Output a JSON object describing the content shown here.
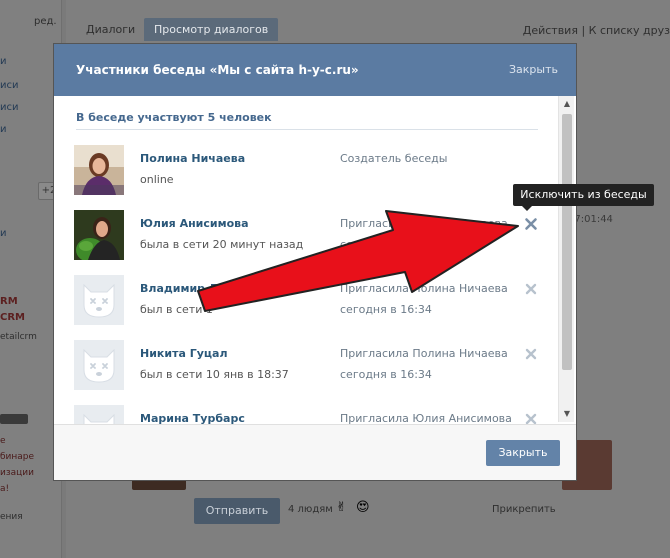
{
  "background": {
    "edit_link": "ред.",
    "sidebar_fragments": [
      "и",
      "иси",
      "иси",
      "и"
    ],
    "sidebar_fragment_2": "и",
    "plus_button": "+2",
    "ad_title_1": "RM",
    "ad_title_2": "CRM",
    "ad_subtitle": "etailcrm",
    "promo_lines": [
      "е",
      "бинаре",
      "изации",
      "а!"
    ],
    "footer_fragment": "ения",
    "tabs": [
      "Диалоги",
      "Просмотр диалогов"
    ],
    "actions": "Действия  |  К списку друз",
    "time": "17:01:44",
    "send_button": "Отправить",
    "people_count": "4 людям",
    "emoji_1": "✌",
    "emoji_2": "😍",
    "attach": "Прикрепить"
  },
  "modal": {
    "title": "Участники беседы «Мы с сайта h-y-c.ru»",
    "close_link": "Закрыть",
    "members_heading": "В беседе участвуют 5 человек",
    "members": [
      {
        "name": "Полина Ничаева",
        "status": "online",
        "role": "Создатель беседы",
        "when": "",
        "avatar": "photo",
        "removable": false
      },
      {
        "name": "Юлия Анисимова",
        "status": "была в сети 20 минут назад",
        "role": "Пригласила Полина Ничаева",
        "when": "сегодня в 1",
        "avatar": "photo",
        "removable": true
      },
      {
        "name": "Владимир Денежный",
        "status": "был в сети 1",
        "role": "Пригласила Полина Ничаева",
        "when": "сегодня в 16:34",
        "avatar": "default",
        "removable": true
      },
      {
        "name": "Никита Гуцал",
        "status": "был в сети 10 янв в 18:37",
        "role": "Пригласила Полина Ничаева",
        "when": "сегодня в 16:34",
        "avatar": "default",
        "removable": true
      },
      {
        "name": "Марина Турбарс",
        "status": "",
        "role": "Пригласила Юлия Анисимова",
        "when": "",
        "avatar": "default",
        "removable": true
      }
    ],
    "footer_close": "Закрыть"
  },
  "tooltip": "Исключить из беседы",
  "colors": {
    "header": "#5b7ba2",
    "link": "#2b587a",
    "button": "#6383a8",
    "annotation_arrow": "#e8101a"
  }
}
